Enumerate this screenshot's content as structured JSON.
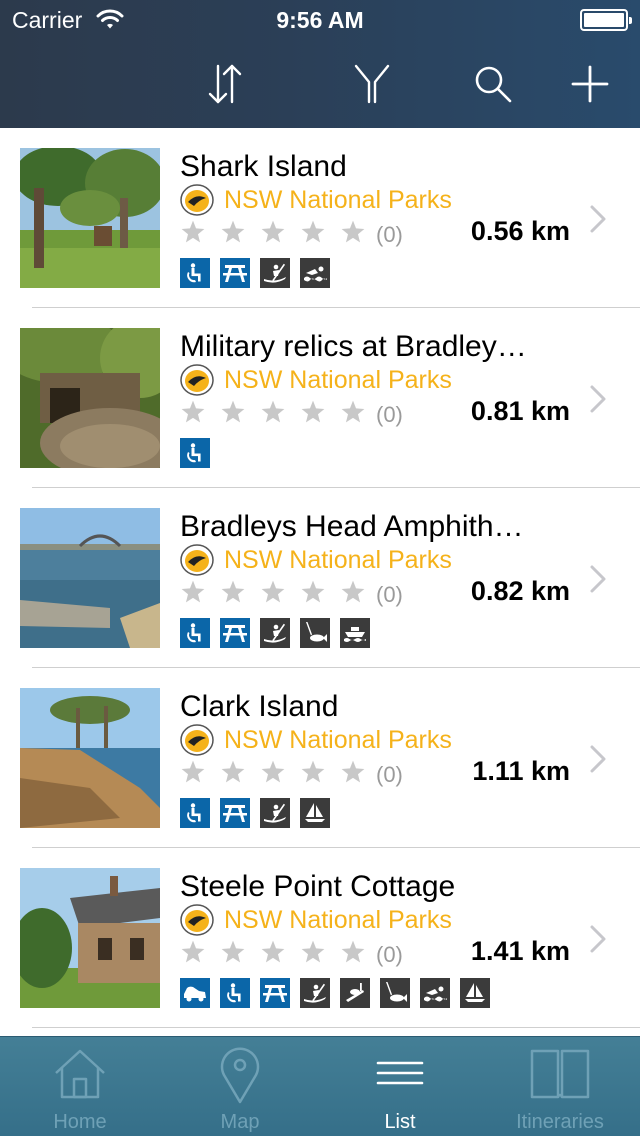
{
  "status_bar": {
    "carrier": "Carrier",
    "time": "9:56 AM"
  },
  "toolbar": {
    "buttons": [
      {
        "name": "sort-icon"
      },
      {
        "name": "filter-icon"
      },
      {
        "name": "search-icon"
      },
      {
        "name": "add-icon"
      }
    ]
  },
  "colors": {
    "provider_text": "#f5b21a",
    "amenity_blue": "#0b66a8",
    "amenity_grey": "#3b3b3b",
    "tabbar": "#3e7a92"
  },
  "places": [
    {
      "title": "Shark Island",
      "provider": "NSW National Parks",
      "reviews": "(0)",
      "rating": 0,
      "distance": "0.56 km",
      "amenities": [
        {
          "icon": "accessible-icon",
          "style": "blue"
        },
        {
          "icon": "picnic-table-icon",
          "style": "blue"
        },
        {
          "icon": "kayak-icon",
          "style": "grey"
        },
        {
          "icon": "swimming-icon",
          "style": "grey"
        }
      ]
    },
    {
      "title": "Military relics at Bradley…",
      "provider": "NSW National Parks",
      "reviews": "(0)",
      "rating": 0,
      "distance": "0.81 km",
      "amenities": [
        {
          "icon": "accessible-icon",
          "style": "blue"
        }
      ]
    },
    {
      "title": "Bradleys Head Amphith…",
      "provider": "NSW National Parks",
      "reviews": "(0)",
      "rating": 0,
      "distance": "0.82 km",
      "amenities": [
        {
          "icon": "accessible-icon",
          "style": "blue"
        },
        {
          "icon": "picnic-table-icon",
          "style": "blue"
        },
        {
          "icon": "kayak-icon",
          "style": "grey"
        },
        {
          "icon": "fishing-icon",
          "style": "grey"
        },
        {
          "icon": "boat-icon",
          "style": "grey"
        }
      ]
    },
    {
      "title": "Clark Island",
      "provider": "NSW National Parks",
      "reviews": "(0)",
      "rating": 0,
      "distance": "1.11 km",
      "amenities": [
        {
          "icon": "accessible-icon",
          "style": "blue"
        },
        {
          "icon": "picnic-table-icon",
          "style": "blue"
        },
        {
          "icon": "kayak-icon",
          "style": "grey"
        },
        {
          "icon": "sailing-icon",
          "style": "grey"
        }
      ]
    },
    {
      "title": "Steele Point Cottage",
      "provider": "NSW National Parks",
      "reviews": "(0)",
      "rating": 0,
      "distance": "1.41 km",
      "amenities": [
        {
          "icon": "car-icon",
          "style": "blue"
        },
        {
          "icon": "accessible-icon",
          "style": "blue"
        },
        {
          "icon": "picnic-table-icon",
          "style": "blue"
        },
        {
          "icon": "kayak-icon",
          "style": "grey"
        },
        {
          "icon": "snorkel-icon",
          "style": "grey"
        },
        {
          "icon": "fishing-icon",
          "style": "grey"
        },
        {
          "icon": "swimming-icon",
          "style": "grey"
        },
        {
          "icon": "sailing-icon",
          "style": "grey"
        }
      ]
    }
  ],
  "tabs": [
    {
      "label": "Home",
      "icon": "home-icon",
      "active": false
    },
    {
      "label": "Map",
      "icon": "map-pin-icon",
      "active": false
    },
    {
      "label": "List",
      "icon": "list-icon",
      "active": true
    },
    {
      "label": "Itineraries",
      "icon": "book-icon",
      "active": false
    }
  ]
}
